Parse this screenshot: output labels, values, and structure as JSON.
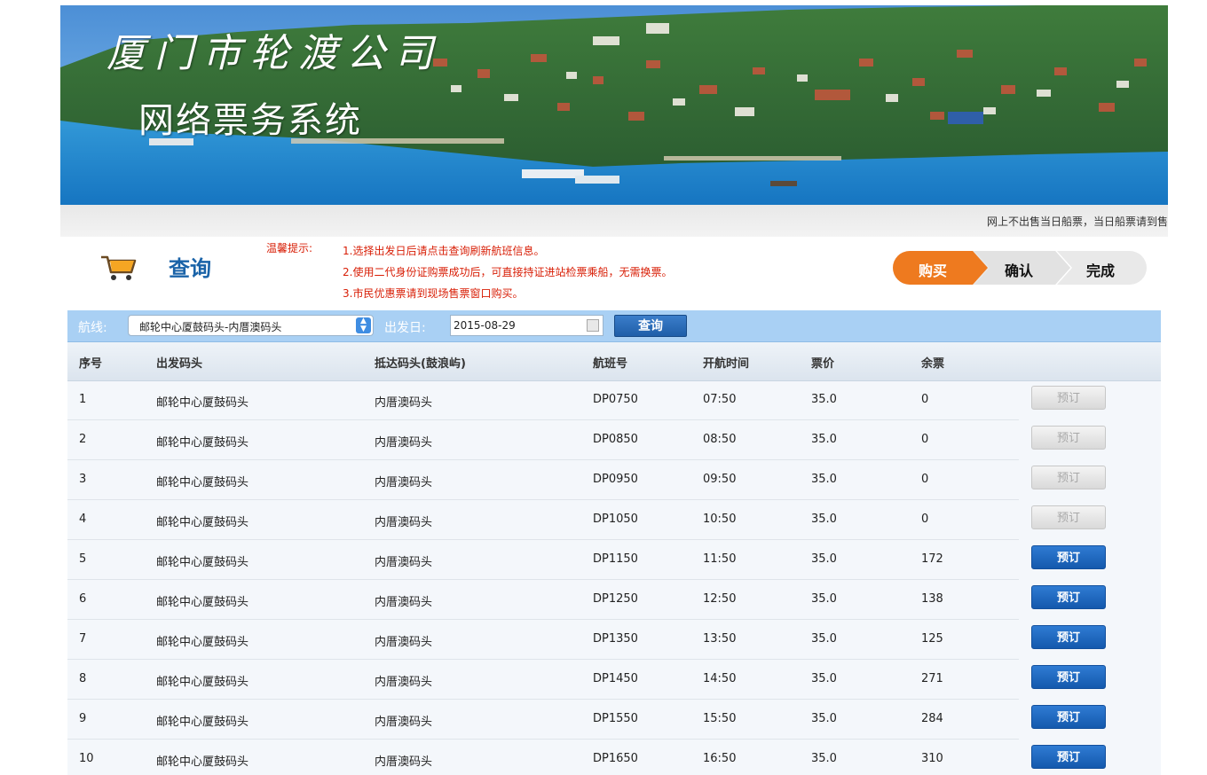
{
  "banner": {
    "brand_title": "厦门市轮渡公司",
    "brand_subtitle": "网络票务系统",
    "notice": "网上不出售当日船票，当日船票请到售"
  },
  "query": {
    "title": "查询",
    "tips_label": "温馨提示:",
    "tips": [
      "1.选择出发日后请点击查询刷新航班信息。",
      "2.使用二代身份证购票成功后，可直接持证进站检票乘船，无需换票。",
      "3.市民优惠票请到现场售票窗口购买。"
    ]
  },
  "steps": [
    "购买",
    "确认",
    "完成"
  ],
  "search": {
    "route_label": "航线:",
    "route_value": "邮轮中心厦鼓码头-内厝澳码头",
    "date_label": "出发日:",
    "date_value": "2015-08-29",
    "button_label": "查询"
  },
  "table": {
    "headers": [
      "序号",
      "出发码头",
      "抵达码头(鼓浪屿)",
      "航班号",
      "开航时间",
      "票价",
      "余票"
    ],
    "rows": [
      {
        "no": "1",
        "from": "邮轮中心厦鼓码头",
        "to": "内厝澳码头",
        "flight": "DP0750",
        "time": "07:50",
        "price": "35.0",
        "remaining": "0",
        "button": "预订",
        "available": false
      },
      {
        "no": "2",
        "from": "邮轮中心厦鼓码头",
        "to": "内厝澳码头",
        "flight": "DP0850",
        "time": "08:50",
        "price": "35.0",
        "remaining": "0",
        "button": "预订",
        "available": false
      },
      {
        "no": "3",
        "from": "邮轮中心厦鼓码头",
        "to": "内厝澳码头",
        "flight": "DP0950",
        "time": "09:50",
        "price": "35.0",
        "remaining": "0",
        "button": "预订",
        "available": false
      },
      {
        "no": "4",
        "from": "邮轮中心厦鼓码头",
        "to": "内厝澳码头",
        "flight": "DP1050",
        "time": "10:50",
        "price": "35.0",
        "remaining": "0",
        "button": "预订",
        "available": false
      },
      {
        "no": "5",
        "from": "邮轮中心厦鼓码头",
        "to": "内厝澳码头",
        "flight": "DP1150",
        "time": "11:50",
        "price": "35.0",
        "remaining": "172",
        "button": "预订",
        "available": true
      },
      {
        "no": "6",
        "from": "邮轮中心厦鼓码头",
        "to": "内厝澳码头",
        "flight": "DP1250",
        "time": "12:50",
        "price": "35.0",
        "remaining": "138",
        "button": "预订",
        "available": true
      },
      {
        "no": "7",
        "from": "邮轮中心厦鼓码头",
        "to": "内厝澳码头",
        "flight": "DP1350",
        "time": "13:50",
        "price": "35.0",
        "remaining": "125",
        "button": "预订",
        "available": true
      },
      {
        "no": "8",
        "from": "邮轮中心厦鼓码头",
        "to": "内厝澳码头",
        "flight": "DP1450",
        "time": "14:50",
        "price": "35.0",
        "remaining": "271",
        "button": "预订",
        "available": true
      },
      {
        "no": "9",
        "from": "邮轮中心厦鼓码头",
        "to": "内厝澳码头",
        "flight": "DP1550",
        "time": "15:50",
        "price": "35.0",
        "remaining": "284",
        "button": "预订",
        "available": true
      },
      {
        "no": "10",
        "from": "邮轮中心厦鼓码头",
        "to": "内厝澳码头",
        "flight": "DP1650",
        "time": "16:50",
        "price": "35.0",
        "remaining": "310",
        "button": "预订",
        "available": true
      }
    ]
  },
  "colors": {
    "accent_blue": "#1a63a8",
    "tip_red": "#d81e06",
    "step_active": "#ee7a1f",
    "search_bar": "#a9d0f4"
  }
}
